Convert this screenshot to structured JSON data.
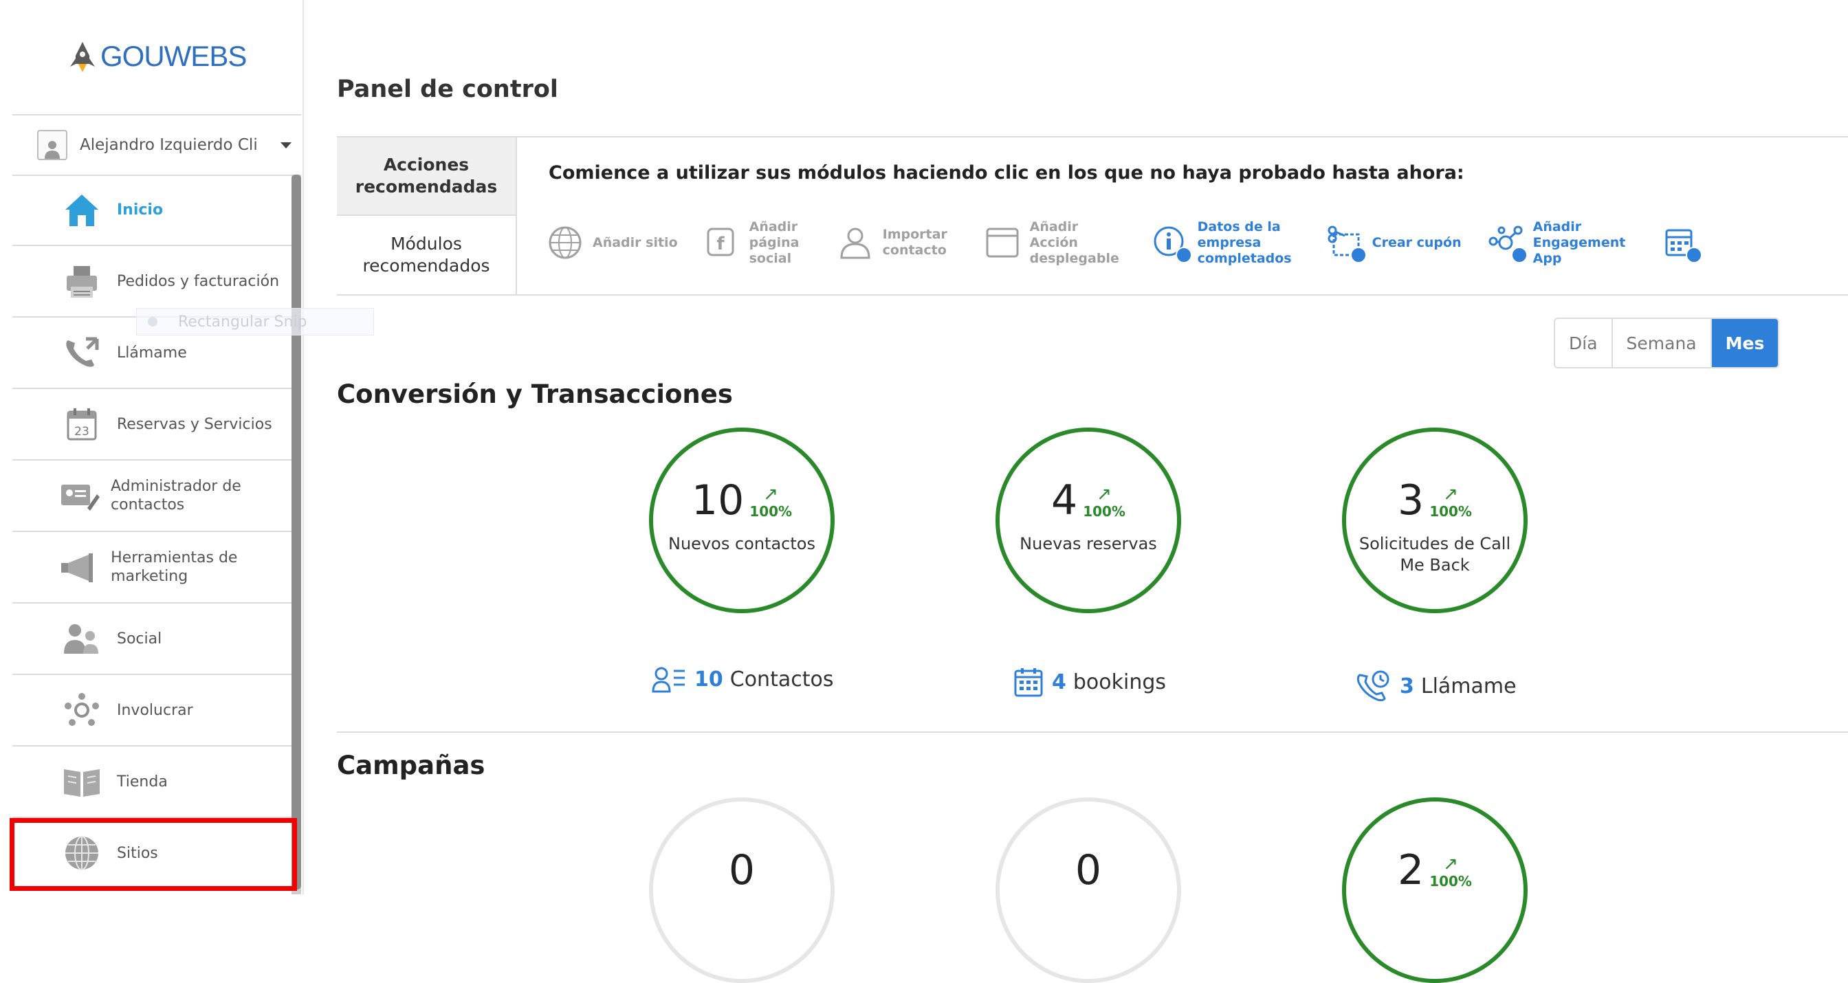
{
  "brand": {
    "name": "GOUWEBS"
  },
  "user": {
    "name": "Alejandro Izquierdo Cli"
  },
  "sidebar": {
    "items": [
      {
        "label": "Inicio",
        "icon": "home-icon"
      },
      {
        "label": "Pedidos y facturación",
        "icon": "printer-icon"
      },
      {
        "label": "Llámame",
        "icon": "phone-icon"
      },
      {
        "label": "Reservas y Servicios",
        "icon": "calendar-icon"
      },
      {
        "label": "Administrador de contactos",
        "icon": "contact-card-icon"
      },
      {
        "label": "Herramientas de marketing",
        "icon": "megaphone-icon"
      },
      {
        "label": "Social",
        "icon": "people-icon"
      },
      {
        "label": "Involucrar",
        "icon": "engage-icon"
      },
      {
        "label": "Tienda",
        "icon": "book-icon"
      },
      {
        "label": "Sitios",
        "icon": "globe-icon"
      }
    ],
    "active_index": 0
  },
  "tooltip_ghost": "Rectangular Snip",
  "page": {
    "title": "Panel de control"
  },
  "panel": {
    "tabs": [
      "Acciones recomendadas",
      "Módulos recomendados"
    ],
    "intro": "Comience a utilizar sus módulos haciendo clic en los que no haya probado hasta ahora:",
    "modules": [
      {
        "label": "Añadir sitio",
        "icon": "globe-icon",
        "done": false
      },
      {
        "label": "Añadir página social",
        "icon": "facebook-icon",
        "done": false
      },
      {
        "label": "Importar contacto",
        "icon": "user-icon",
        "done": false
      },
      {
        "label": "Añadir Acción desplegable",
        "icon": "window-icon",
        "done": false
      },
      {
        "label": "Datos de la empresa completados",
        "icon": "info-icon",
        "done": true
      },
      {
        "label": "Crear cupón",
        "icon": "coupon-icon",
        "done": true
      },
      {
        "label": "Añadir Engagement App",
        "icon": "engagement-icon",
        "done": true
      },
      {
        "label": "",
        "icon": "calendar-check-icon",
        "done": true
      }
    ]
  },
  "range": {
    "options": [
      "Día",
      "Semana",
      "Mes"
    ],
    "selected": "Mes"
  },
  "conversion": {
    "title": "Conversión y Transacciones",
    "circles": [
      {
        "value": "10",
        "trend": "100%",
        "label": "Nuevos contactos"
      },
      {
        "value": "4",
        "trend": "100%",
        "label": "Nuevas reservas"
      },
      {
        "value": "3",
        "trend": "100%",
        "label": "Solicitudes de Call Me Back"
      }
    ],
    "links": [
      {
        "num": "10",
        "label": "Contactos"
      },
      {
        "num": "4",
        "label": "bookings"
      },
      {
        "num": "3",
        "label": "Llámame"
      }
    ]
  },
  "campaigns": {
    "title": "Campañas",
    "circles": [
      {
        "value": "0"
      },
      {
        "value": "0"
      },
      {
        "value": "2",
        "trend": "100%"
      }
    ]
  },
  "colors": {
    "accent": "#2e7fd8",
    "active_nav": "#2e9fd8",
    "success": "#2a8a2a",
    "highlight": "#f00000"
  }
}
